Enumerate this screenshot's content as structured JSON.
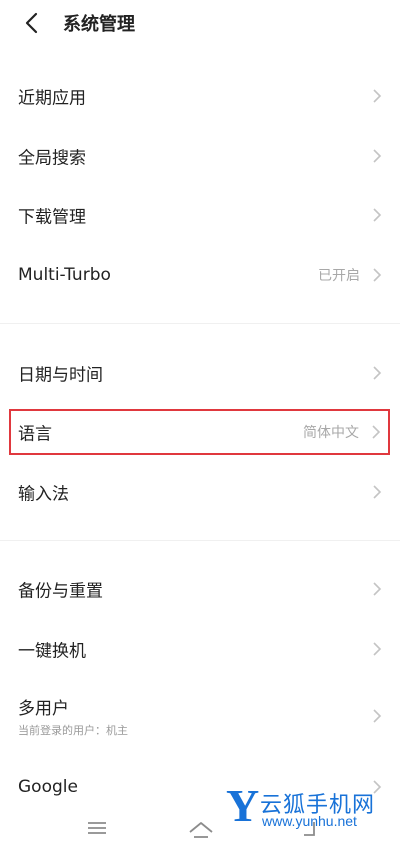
{
  "header": {
    "title": "系统管理"
  },
  "rows": [
    {
      "label": "近期应用"
    },
    {
      "label": "全局搜索"
    },
    {
      "label": "下载管理"
    },
    {
      "label": "Multi-Turbo",
      "value": "已开启"
    },
    {
      "label": "日期与时间"
    },
    {
      "label": "语言",
      "value": "简体中文"
    },
    {
      "label": "输入法"
    },
    {
      "label": "备份与重置"
    },
    {
      "label": "一键换机"
    },
    {
      "label": "多用户",
      "sublabel": "当前登录的用户：机主"
    },
    {
      "label": "Google"
    }
  ],
  "highlight_color": "#e0383e",
  "watermark": {
    "y": "Y",
    "name": "云狐手机网",
    "url": "www.yunhu.net"
  }
}
